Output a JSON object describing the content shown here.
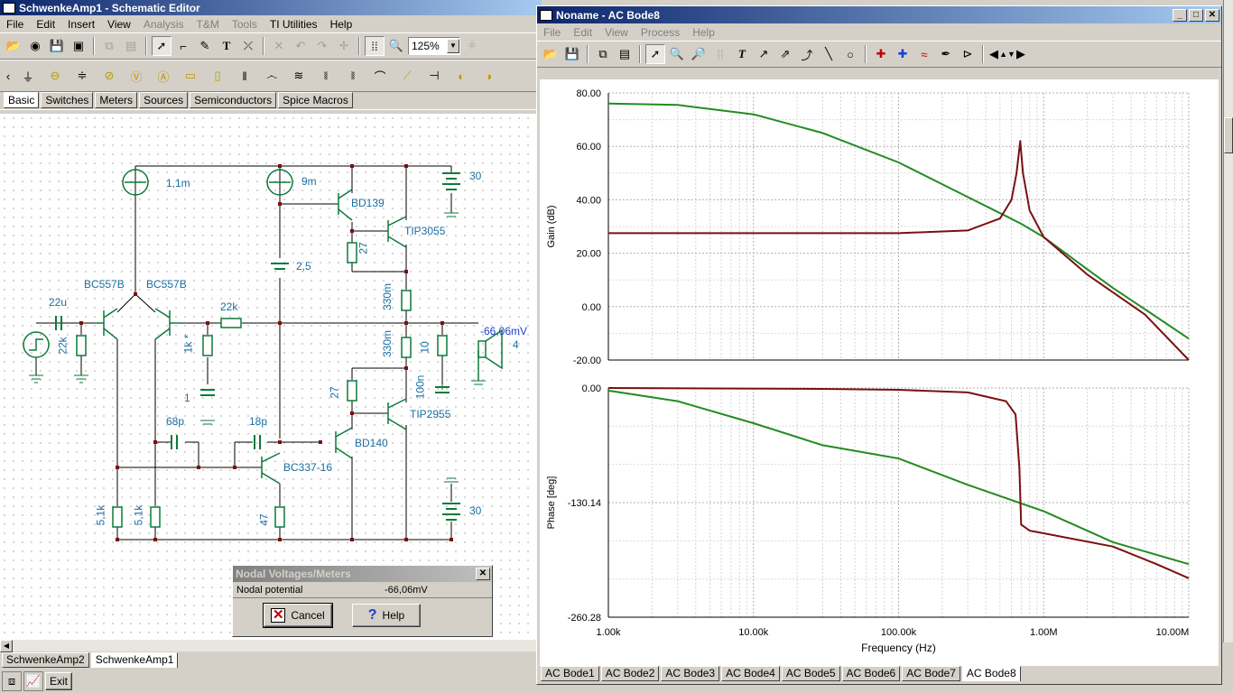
{
  "schematic": {
    "title": "SchwenkeAmp1 - Schematic Editor",
    "menu": [
      {
        "label": "File",
        "enabled": true
      },
      {
        "label": "Edit",
        "enabled": true
      },
      {
        "label": "Insert",
        "enabled": true
      },
      {
        "label": "View",
        "enabled": true
      },
      {
        "label": "Analysis",
        "enabled": false
      },
      {
        "label": "T&M",
        "enabled": false
      },
      {
        "label": "Tools",
        "enabled": false
      },
      {
        "label": "TI Utilities",
        "enabled": true
      },
      {
        "label": "Help",
        "enabled": true
      }
    ],
    "zoom": "125%",
    "component_tabs": [
      "Basic",
      "Switches",
      "Meters",
      "Sources",
      "Semiconductors",
      "Spice Macros"
    ],
    "active_component_tab": "Basic",
    "labels": {
      "i1": "1,1m",
      "i2": "9m",
      "v1": "30",
      "v2": "30",
      "v3": "2,5",
      "q1": "BC557B",
      "q2": "BC557B",
      "q3": "BD139",
      "q4": "TIP3055",
      "q5": "BD140",
      "q6": "TIP2955",
      "q7": "BC337-16",
      "c_in": "22u",
      "r_in": "22k",
      "r_fb": "22k",
      "r_1k": "1k *",
      "c_1": "1",
      "c_68p": "68p",
      "c_18p": "18p",
      "r_27a": "27",
      "r_27b": "27",
      "r_330a": "330m",
      "r_330b": "330m",
      "r_10": "10",
      "c_100n": "100n",
      "r_51a": "5,1k",
      "r_51b": "5,1k",
      "r_47": "47",
      "out_v": "-66,06mV",
      "load": "4"
    },
    "doc_tabs": [
      "SchwenkeAmp2",
      "SchwenkeAmp1"
    ],
    "active_doc_tab": "SchwenkeAmp1",
    "bottom_exit": "Exit"
  },
  "nodal_dialog": {
    "title": "Nodal Voltages/Meters",
    "row_label": "Nodal potential",
    "row_value": "-66,06mV",
    "cancel": "Cancel",
    "help": "Help"
  },
  "bode": {
    "title": "Noname - AC Bode8",
    "menu": [
      "File",
      "Edit",
      "View",
      "Process",
      "Help"
    ],
    "tabs": [
      "AC Bode1",
      "AC Bode2",
      "AC Bode3",
      "AC Bode4",
      "AC Bode5",
      "AC Bode6",
      "AC Bode7",
      "AC Bode8"
    ],
    "active_tab": "AC Bode8"
  },
  "chart_data": [
    {
      "type": "line",
      "ylabel": "Gain (dB)",
      "x_scale": "log",
      "xlim": [
        1000,
        10000000
      ],
      "ylim": [
        -20,
        80
      ],
      "yticks": [
        "80.00",
        "60.00",
        "40.00",
        "20.00",
        "0.00",
        "-20.00"
      ],
      "series": [
        {
          "color": "#228b22",
          "x": [
            1000,
            3000,
            10000,
            30000,
            100000,
            300000,
            500000,
            700000,
            1000000,
            2000000,
            3000000,
            5000000,
            10000000
          ],
          "y": [
            76,
            75.5,
            72,
            65,
            54,
            41,
            35,
            31,
            26,
            14,
            7,
            -1,
            -12
          ]
        },
        {
          "color": "#7a1010",
          "x": [
            1000,
            10000,
            100000,
            300000,
            500000,
            600000,
            650000,
            690000,
            720000,
            800000,
            1000000,
            2000000,
            5000000,
            10000000
          ],
          "y": [
            27.5,
            27.5,
            27.5,
            28.5,
            33,
            40,
            50,
            62,
            50,
            36,
            26,
            12,
            -3,
            -20
          ]
        }
      ]
    },
    {
      "type": "line",
      "xlabel": "Frequency (Hz)",
      "ylabel": "Phase [deg]",
      "x_scale": "log",
      "xlim": [
        1000,
        10000000
      ],
      "ylim": [
        -260.28,
        0
      ],
      "yticks": [
        "0.00",
        "-130.14",
        "-260.28"
      ],
      "xticks": [
        "1.00k",
        "10.00k",
        "100.00k",
        "1.00M",
        "10.00M"
      ],
      "series": [
        {
          "color": "#228b22",
          "x": [
            1000,
            3000,
            10000,
            30000,
            100000,
            300000,
            1000000,
            3000000,
            10000000
          ],
          "y": [
            -3,
            -15,
            -40,
            -65,
            -80,
            -110,
            -140,
            -175,
            -200
          ]
        },
        {
          "color": "#7a1010",
          "x": [
            1000,
            30000,
            100000,
            300000,
            550000,
            640000,
            680000,
            700000,
            800000,
            1000000,
            3000000,
            6000000,
            10000000
          ],
          "y": [
            0,
            -1,
            -2,
            -5,
            -15,
            -30,
            -90,
            -155,
            -162,
            -165,
            -180,
            -200,
            -216
          ]
        }
      ]
    }
  ]
}
